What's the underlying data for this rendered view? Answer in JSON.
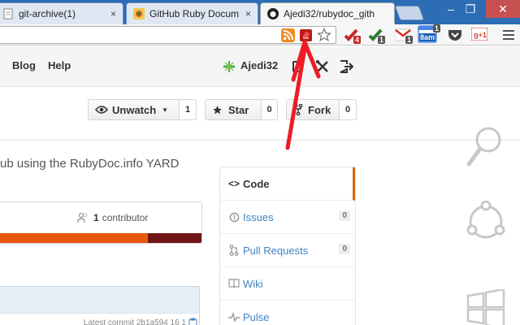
{
  "tabs": [
    {
      "title": "git-archive(1)",
      "favicon": "document-icon"
    },
    {
      "title": "GitHub Ruby Docum",
      "favicon": "github-page-icon"
    },
    {
      "title": "Ajedi32/rubydoc_gith",
      "favicon": "github-octocat-icon"
    }
  ],
  "tab_close_glyph": "×",
  "window_controls": {
    "minimize": "–",
    "restore": "❐",
    "close": "✕"
  },
  "extensions": {
    "rss": "rss-icon",
    "rubydoc": "rubydoc-extension-icon",
    "star": "bookmark-star-icon",
    "ext1_badge": "4",
    "ext2_badge": "1",
    "gmail_badge": "1",
    "calendar_time": "8am",
    "calendar_badge": "1",
    "gplus_label": "g+1"
  },
  "header": {
    "nav": [
      "Blog",
      "Help"
    ],
    "username": "Ajedi32"
  },
  "actions": {
    "watch": {
      "label": "Unwatch",
      "count": "1"
    },
    "star": {
      "label": "Star",
      "count": "0"
    },
    "fork": {
      "label": "Fork",
      "count": "0"
    }
  },
  "repo": {
    "description": "ub using the RubyDoc.info YARD",
    "contributors_count": "1",
    "contributors_label": "contributor",
    "file_line": "Latest commit 2b1a594 16 1"
  },
  "sidebar": [
    {
      "label": "Code",
      "icon": "code-icon",
      "count": null,
      "selected": true
    },
    {
      "label": "Issues",
      "icon": "issues-icon",
      "count": "0",
      "selected": false
    },
    {
      "label": "Pull Requests",
      "icon": "pull-request-icon",
      "count": "0",
      "selected": false
    },
    {
      "label": "Wiki",
      "icon": "wiki-book-icon",
      "count": null,
      "selected": false
    },
    {
      "label": "Pulse",
      "icon": "pulse-icon",
      "count": null,
      "selected": false
    }
  ],
  "colors": {
    "tabstrip": "#2d6db4",
    "annotation_arrow": "#ee1c25",
    "lang_primary": "#e8570f",
    "lang_secondary": "#701516",
    "selected_accent": "#d26911",
    "link": "#4183c4"
  },
  "language_bar": [
    {
      "share": 0.74,
      "color": "#e8570f"
    },
    {
      "share": 0.26,
      "color": "#701516"
    }
  ],
  "charms": [
    "search-charm-icon",
    "share-charm-icon",
    "start-charm-icon"
  ]
}
